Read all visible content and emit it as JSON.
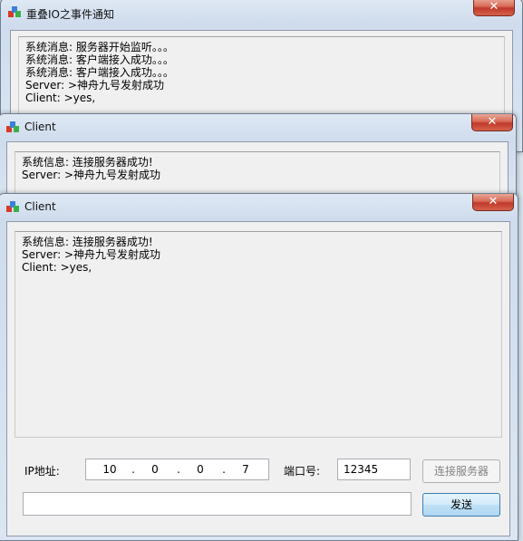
{
  "server_window": {
    "title": "重叠IO之事件通知",
    "close_label": "✕",
    "log_lines": [
      "系统消息: 服务器开始监听。。。",
      "系统消息: 客户端接入成功。。。",
      "系统消息: 客户端接入成功。。。",
      "Server: >神舟九号发射成功",
      "Client: >yes,"
    ]
  },
  "client_window_1": {
    "title": "Client",
    "close_label": "✕",
    "log_lines": [
      "系统信息: 连接服务器成功!",
      "Server: >神舟九号发射成功"
    ]
  },
  "client_window_2": {
    "title": "Client",
    "close_label": "✕",
    "log_lines": [
      "系统信息: 连接服务器成功!",
      "Server: >神舟九号发射成功",
      "Client: >yes,"
    ],
    "ip_label": "IP地址:",
    "ip_octets": [
      "10",
      "0",
      "0",
      "7"
    ],
    "ip_dot": ".",
    "port_label": "端口号:",
    "port_value": "12345",
    "connect_button": "连接服务器",
    "message_value": "",
    "send_button": "发送"
  }
}
